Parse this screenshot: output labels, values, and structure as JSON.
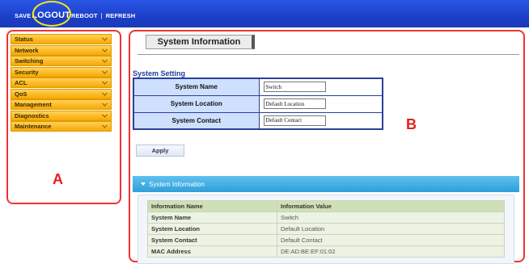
{
  "topmenu": {
    "save": "SAVE",
    "logout": "LOGOUT",
    "reboot": "REBOOT",
    "sep": "|",
    "refresh": "REFRESH"
  },
  "sidebar": {
    "items": [
      {
        "label": "Status"
      },
      {
        "label": "Network"
      },
      {
        "label": "Switching"
      },
      {
        "label": "Security"
      },
      {
        "label": "ACL"
      },
      {
        "label": "QoS"
      },
      {
        "label": "Management"
      },
      {
        "label": "Diagnostics"
      },
      {
        "label": "Maintenance"
      }
    ],
    "chevron_icon": "chevron-down-icon",
    "panel_label": "A"
  },
  "main": {
    "page_title": "System Information",
    "panel_label": "B",
    "setting": {
      "title": "System Setting",
      "rows": [
        {
          "label": "System Name",
          "value": "Switch"
        },
        {
          "label": "System Location",
          "value": "Default Location"
        },
        {
          "label": "System Contact",
          "value": "Default Contact"
        }
      ],
      "apply_label": "Apply"
    },
    "info": {
      "bar_title": "System Information",
      "headers": [
        "Information Name",
        "Information Value"
      ],
      "rows": [
        {
          "name": "System Name",
          "value": "Switch"
        },
        {
          "name": "System Location",
          "value": "Default Location"
        },
        {
          "name": "System Contact",
          "value": "Default Contact"
        },
        {
          "name": "MAC Address",
          "value": "DE:AD:BE:EF:01:02"
        }
      ]
    }
  },
  "colors": {
    "topbar": "#1c3fc9",
    "menu_item": "#f7a800",
    "annotation_red": "#e32020",
    "highlight_yellow": "#f5e51a",
    "section_blue": "#1d3c9e",
    "info_bar": "#2f9fd9"
  }
}
